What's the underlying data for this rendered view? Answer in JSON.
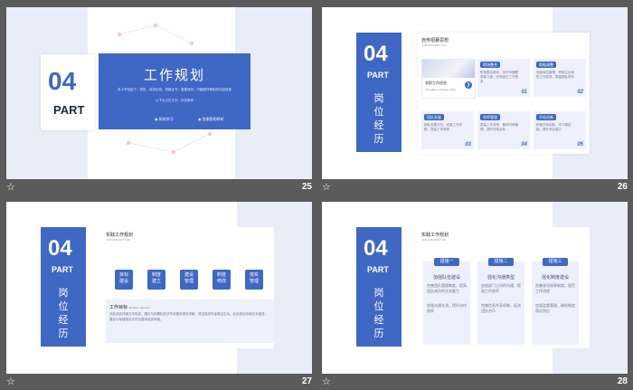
{
  "colors": {
    "accent": "#3f67c4",
    "light": "#eef1fb",
    "gap": "#5b5b5b"
  },
  "icons": {
    "slide_marker": "star-outline-icon"
  },
  "slides": [
    {
      "number": "25",
      "badge_num": "04",
      "badge_part": "PART",
      "title": "工作规划",
      "body_lines": [
        "本小节包括了：学历、培训记录、资格证书、重要经历、兴趣爱好等相关内容信息",
        "以下为占位文字，仅供参考"
      ],
      "links": [
        "如何学习",
        "答谢您的聆听"
      ]
    },
    {
      "number": "26",
      "badge_num": "04",
      "badge_part": "PART",
      "vertical_text": "岗位经历",
      "section_title": "自传招募思想",
      "section_sub": "JOB DESCRIPTION",
      "photo_caption": "求职工作经验",
      "photo_sub": "Thoughts on Future Work",
      "cards": [
        {
          "title": "职场整合",
          "text": "职场整合原则，合作沟通要求能力强，完成岗位工作需求",
          "num": "01"
        },
        {
          "title": "职能调整",
          "text": "加强岗位管理，积极主动承担工作安排，提高团队协作",
          "num": "02"
        },
        {
          "title": "团队发展",
          "text": "团队发展方向，完善工作流程，提高工作效率",
          "num": "03"
        },
        {
          "title": "效率管理",
          "text": "提高工作效率，做好时间管理，按时完成目标",
          "num": "04"
        },
        {
          "title": "开拓创新",
          "text": "积极开拓创新，学习新技能，提升综合能力",
          "num": "05"
        }
      ]
    },
    {
      "number": "27",
      "badge_num": "04",
      "badge_part": "PART",
      "vertical_text": "岗位经历",
      "section_title": "实践工作规划",
      "section_sub": "JOB DESCRIPTION",
      "steps": [
        "目标\n建设",
        "制度\n建立",
        "建设\n管理",
        "制度\n修改",
        "落实\n管理"
      ],
      "paragraph_title": "工作目标",
      "paragraph_title_en": "Working objective",
      "paragraph": "此处添加详细文本描述，建议与标题相关并符合整体语言风格，语言描述尽量简洁生动。此处添加详细文本描述，建议与标题相关并符合整体语言风格。"
    },
    {
      "number": "28",
      "badge_num": "04",
      "badge_part": "PART",
      "vertical_text": "岗位经历",
      "section_title": "实践工作规划",
      "section_sub": "JOB DESCRIPTION",
      "columns": [
        {
          "pill": "措施一",
          "heading": "加强队伍建设",
          "lines": [
            "完善团队管理制度，提高团队成员的业务能力",
            "加强沟通交流，提升协作效率"
          ]
        },
        {
          "pill": "措施二",
          "heading": "强化沟通类型",
          "lines": [
            "加强部门之间的沟通，提高工作效率",
            "完善信息共享机制，促进团队合作"
          ]
        },
        {
          "pill": "措施三",
          "heading": "强化制度建设",
          "lines": [
            "完善各项规章制度，规范工作流程",
            "加强监督管理，确保制度落实到位"
          ]
        }
      ]
    }
  ]
}
